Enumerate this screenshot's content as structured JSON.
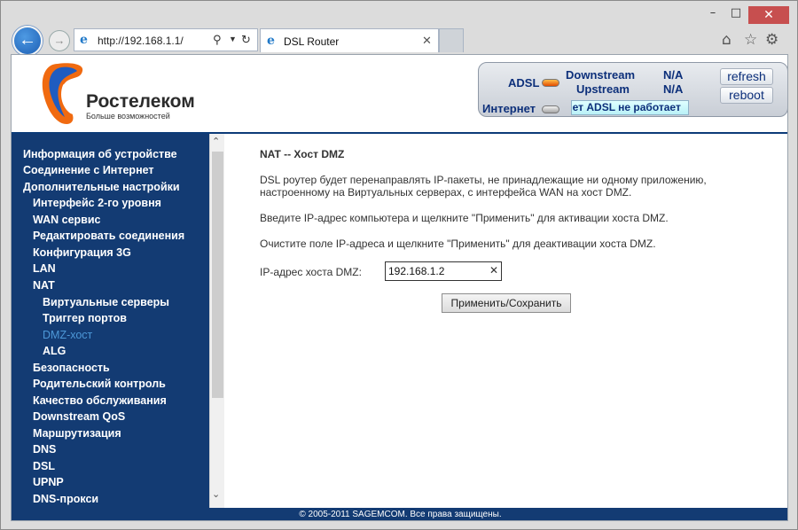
{
  "browser": {
    "address_url": "http://192.168.1.1/",
    "tab_title": "DSL Router",
    "window_minimize": "–",
    "window_maximize": "□",
    "window_close": "✕"
  },
  "header": {
    "brand": "Ростелеком",
    "tagline": "Больше возможностей",
    "status": {
      "adsl_label": "ADSL",
      "downstream_label": "Downstream",
      "downstream_value": "N/A",
      "upstream_label": "Upstream",
      "upstream_value": "N/A",
      "internet_label": "Интернет",
      "banner_text": "Нет ADSL не работает",
      "refresh_label": "refresh",
      "reboot_label": "reboot"
    }
  },
  "sidebar": {
    "items": [
      {
        "label": "Информация об устройстве",
        "level": 0
      },
      {
        "label": "Соединение с Интернет",
        "level": 0
      },
      {
        "label": "Дополнительные настройки",
        "level": 0
      },
      {
        "label": "Интерфейс 2-го уровня",
        "level": 1
      },
      {
        "label": "WAN сервис",
        "level": 1
      },
      {
        "label": "Редактировать соединения",
        "level": 1
      },
      {
        "label": "Конфигурация 3G",
        "level": 1
      },
      {
        "label": "LAN",
        "level": 1
      },
      {
        "label": "NAT",
        "level": 1
      },
      {
        "label": "Виртуальные серверы",
        "level": 2
      },
      {
        "label": "Триггер портов",
        "level": 2
      },
      {
        "label": "DMZ-хост",
        "level": 2,
        "active": true
      },
      {
        "label": "ALG",
        "level": 2
      },
      {
        "label": "Безопасность",
        "level": 1
      },
      {
        "label": "Родительский контроль",
        "level": 1
      },
      {
        "label": "Качество обслуживания",
        "level": 1
      },
      {
        "label": "Downstream QoS",
        "level": 1
      },
      {
        "label": "Маршрутизация",
        "level": 1
      },
      {
        "label": "DNS",
        "level": 1
      },
      {
        "label": "DSL",
        "level": 1
      },
      {
        "label": "UPNP",
        "level": 1
      },
      {
        "label": "DNS-прокси",
        "level": 1
      }
    ]
  },
  "main": {
    "title": "NAT -- Хост DMZ",
    "paragraph1": "DSL роутер будет перенаправлять IP-пакеты, не принадлежащие ни одному приложению, настроенному на Виртуальных серверах, с интерфейса WAN на хост DMZ.",
    "paragraph2": "Введите IP-адрес компьютера и щелкните \"Применить\" для активации хоста DMZ.",
    "paragraph3": "Очистите поле IP-адреса и щелкните \"Применить\" для деактивации хоста DMZ.",
    "ip_label": "IP-адрес хоста DMZ:",
    "ip_value": "192.168.1.2",
    "apply_label": "Применить/Сохранить"
  },
  "footer": {
    "copyright": "© 2005-2011 SAGEMCOM. Все права защищены."
  },
  "colors": {
    "sidebar_bg": "#133b73",
    "active_item": "#4d98d8",
    "accent": "#0c2f7a"
  }
}
